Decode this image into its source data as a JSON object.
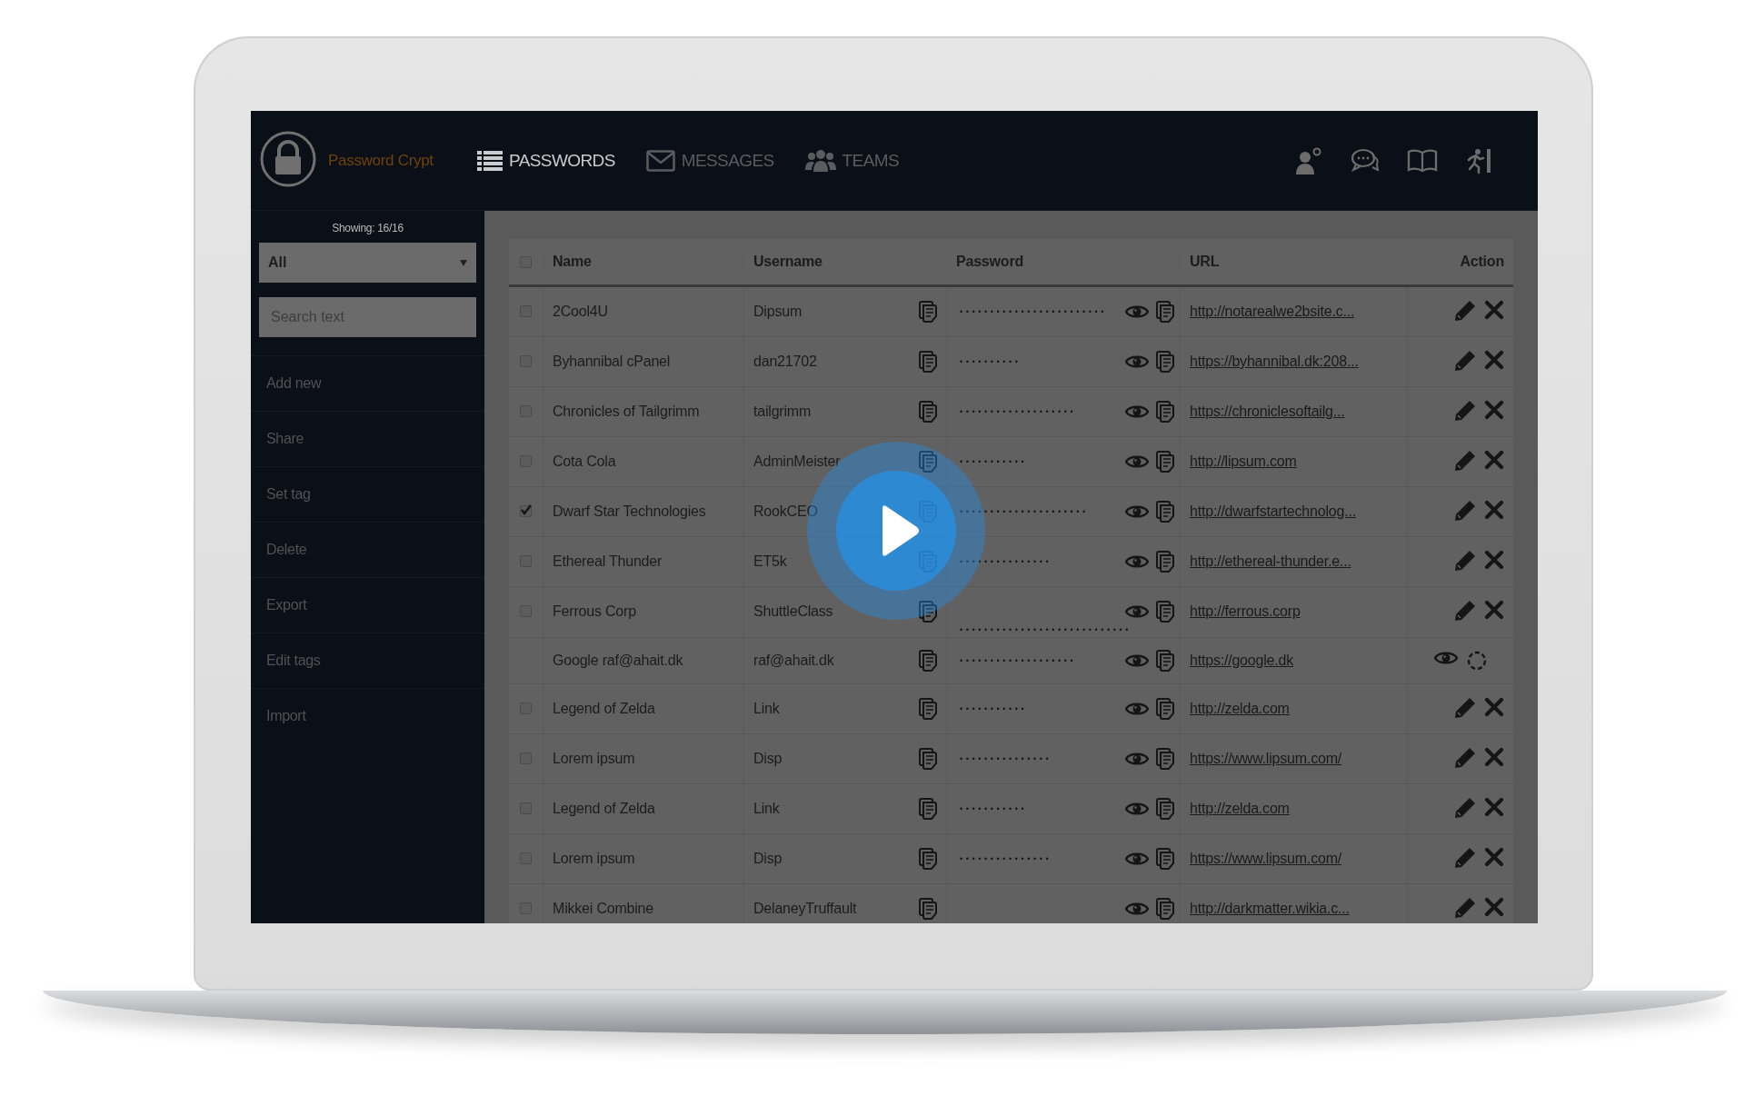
{
  "app": {
    "title": "Password Crypt"
  },
  "nav": [
    {
      "label": "PASSWORDS",
      "selected": true
    },
    {
      "label": "MESSAGES",
      "selected": false
    },
    {
      "label": "TEAMS",
      "selected": false
    }
  ],
  "sidebar": {
    "count": "Showing: 16/16",
    "filter": {
      "value": "All"
    },
    "search": {
      "placeholder": "Search text"
    },
    "items": [
      "Add new",
      "Share",
      "Set tag",
      "Delete",
      "Export",
      "Edit tags",
      "Import"
    ]
  },
  "table": {
    "select_all": {
      "checked": false
    },
    "columns": [
      "Name",
      "Username",
      "Password",
      "URL",
      "Action"
    ],
    "rows": [
      {
        "kind": "entry",
        "checked": false,
        "name": "2Cool4U",
        "username": "Dipsum",
        "password": "••••••••••••••••••••••••",
        "url": "http://notarealwe2bsite.c..."
      },
      {
        "kind": "entry",
        "checked": false,
        "name": "Byhannibal cPanel",
        "username": "dan21702",
        "password": "••••••••••",
        "url": "https://byhannibal.dk:208..."
      },
      {
        "kind": "entry",
        "checked": false,
        "name": "Chronicles of Tailgrimm",
        "username": "tailgrimm",
        "password": "•••••••••••••••••••",
        "url": "https://chroniclesoftailg..."
      },
      {
        "kind": "entry",
        "checked": false,
        "name": "Cota Cola",
        "username": "AdminMeister",
        "password": "•••••••••••",
        "url": "http://lipsum.com"
      },
      {
        "kind": "entry",
        "checked": true,
        "name": "Dwarf Star Technologies",
        "username": "RookCEO",
        "password": "•••••••••••••••••••••",
        "url": "http://dwarfstartechnolog..."
      },
      {
        "kind": "entry",
        "checked": false,
        "name": "Ethereal Thunder",
        "username": "ET5k",
        "password": "•••••••••••••••",
        "url": "http://ethereal-thunder.e..."
      },
      {
        "kind": "entry",
        "checked": false,
        "name": "Ferrous Corp",
        "username": "ShuttleClass",
        "password": "••••••••••••••••••••••••••••",
        "url": "http://ferrous.corp"
      },
      {
        "kind": "shared",
        "name": "Google raf@ahait.dk",
        "username": "raf@ahait.dk",
        "password": "•••••••••••••••••••",
        "url": "https://google.dk"
      },
      {
        "kind": "entry",
        "checked": false,
        "name": "Legend of Zelda",
        "username": "Link",
        "password": "•••••••••••",
        "url": "http://zelda.com"
      },
      {
        "kind": "entry",
        "checked": false,
        "name": "Lorem ipsum",
        "username": "Disp",
        "password": "•••••••••••••••",
        "url": "https://www.lipsum.com/"
      },
      {
        "kind": "entry",
        "checked": false,
        "name": "Legend of Zelda",
        "username": "Link",
        "password": "•••••••••••",
        "url": "http://zelda.com"
      },
      {
        "kind": "entry",
        "checked": false,
        "name": "Lorem ipsum",
        "username": "Disp",
        "password": "•••••••••••••••",
        "url": "https://www.lipsum.com/"
      },
      {
        "kind": "entry",
        "checked": false,
        "name": "Mikkei Combine",
        "username": "DelaneyTruffault",
        "url": "http://darkmatter.wikia.c..."
      }
    ]
  }
}
